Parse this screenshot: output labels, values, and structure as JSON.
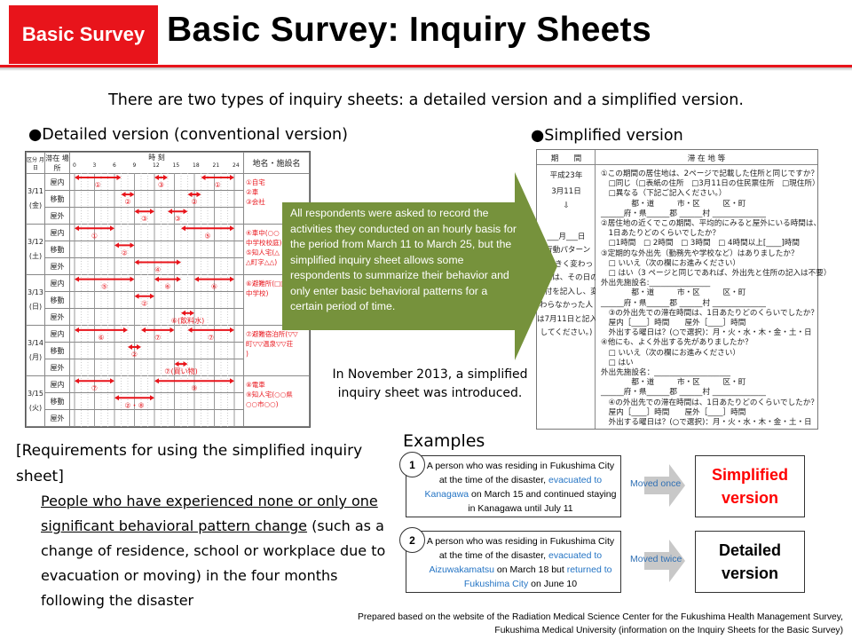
{
  "header": {
    "badge": "Basic Survey",
    "title": "Basic Survey: Inquiry Sheets"
  },
  "intro": "There are two types of inquiry sheets: a detailed version and a simplified version.",
  "detailed": {
    "heading": "●Detailed version (conventional version)",
    "form": {
      "col_date": "区分 月日",
      "col_place": "滞在 場所",
      "col_time": "時 刻",
      "col_names": "地名・施設名",
      "hour_ticks": [
        "0",
        "3",
        "6",
        "9",
        "12",
        "15",
        "18",
        "21",
        "24"
      ],
      "place_types": [
        "屋内",
        "移動",
        "屋外"
      ],
      "days": [
        {
          "date": "3/11",
          "weekday": "(金)",
          "notes": [
            "①自宅",
            "②車",
            "③会社"
          ],
          "rows": [
            [
              [
                0,
                7,
                "①"
              ],
              [
                12,
                14,
                "③"
              ],
              [
                19,
                24,
                "①"
              ]
            ],
            [
              [
                7,
                9,
                "②"
              ],
              [
                17,
                19,
                "②"
              ]
            ],
            [
              [
                9,
                12,
                "③"
              ],
              [
                14,
                17,
                "③"
              ]
            ]
          ]
        },
        {
          "date": "3/12",
          "weekday": "(土)",
          "notes": [
            "④車中(○○",
            "中学校校庭)",
            "⑤知人宅(△",
            "△町字△△)"
          ],
          "rows": [
            [
              [
                0,
                6,
                "①"
              ],
              [
                16,
                24,
                "⑤"
              ]
            ],
            [
              [
                6,
                9,
                "②"
              ]
            ],
            [
              [
                9,
                16,
                "④"
              ]
            ]
          ]
        },
        {
          "date": "3/13",
          "weekday": "(日)",
          "notes": [
            "⑥避難所(□□",
            "中学校)"
          ],
          "rows": [
            [
              [
                0,
                9,
                "⑤"
              ],
              [
                12,
                16,
                "⑥"
              ],
              [
                18,
                24,
                "⑥"
              ]
            ],
            [
              [
                9,
                12,
                "②"
              ]
            ],
            [
              [
                16,
                18,
                "⑥(飲料水)"
              ]
            ]
          ]
        },
        {
          "date": "3/14",
          "weekday": "(月)",
          "notes": [
            "⑦避難宿泊所(▽▽",
            "町▽▽温泉▽▽荘",
            ")"
          ],
          "rows": [
            [
              [
                0,
                8,
                "⑥"
              ],
              [
                10,
                15,
                "⑦"
              ],
              [
                17,
                24,
                "⑦"
              ]
            ],
            [
              [
                8,
                10,
                "②"
              ]
            ],
            [
              [
                15,
                17,
                "⑦(買い物)"
              ]
            ]
          ]
        },
        {
          "date": "3/15",
          "weekday": "(火)",
          "notes": [
            "⑧電車",
            "⑨知人宅(○○県",
            "○○市○○)"
          ],
          "rows": [
            [
              [
                0,
                6,
                "⑦"
              ],
              [
                12,
                24,
                "⑨"
              ]
            ],
            [
              [
                6,
                12,
                "②・⑧"
              ]
            ],
            []
          ]
        }
      ],
      "bar_color": "#e8141b"
    }
  },
  "simplified": {
    "heading": "●Simplified version",
    "form": {
      "col_period": "期　　間",
      "col_stay": "滞 在 地 等",
      "left": [
        "平成23年",
        "3月11日",
        "⇩",
        "___月___日",
        "(行動パターン",
        "が大きく変わっ",
        "た人は、その日の",
        "日付を記入し、変",
        "わらなかった人",
        "は7月11日と記入",
        "してください。)"
      ],
      "lines": [
        "①この期間の居住地は、2ページで記載した住所と同じですか？",
        "　□同じ（□表紙の住所　□3月11日の住民票住所　□現住所）",
        "　□異なる（下記ご記入ください。）",
        "　　　　都・道　　　市・区　　　区・町",
        "______府・県______郡 ______村 ______________",
        "②居住地の近くでこの期間、平均的にみると屋外にいる時間は、",
        "　1日あたりどのくらいでしたか？",
        "　□1時間　□ 2時間　□ 3時間　□ 4時間以上[____]時間",
        "③定期的な外出先（勤務先や学校など）はありましたか？",
        "　□ いいえ（次の欄にお進みください）",
        "　□ はい（3 ページと同じであれば、外出先と住所の記入は不要）",
        "外出先施設名:________________",
        "　　　　都・道　　　市・区　　　区・町",
        "______府・県______郡 ______村 ______________",
        "　③の外出先での滞在時間は、1日あたりどのくらいでしたか？",
        "　屋内［____］時間　　屋外［____］時間",
        "　外出する曜日は？(○で選択)：月・火・水・木・金・土・日",
        "④他にも、よく外出する先がありましたか？",
        "　□ いいえ（次の欄にお進みください）",
        "　□ はい",
        "外出先施設名：____________________",
        "　　　　都・道　　　市・区　　　区・町",
        "______府・県______郡 ______村 ______________",
        "　④の外出先での滞在時間は、1日あたりどのくらいでしたか？",
        "　屋内［____］時間　　屋外［____］時間",
        "　外出する曜日は？(○で選択)：月・火・水・木・金・土・日"
      ]
    }
  },
  "callout": {
    "text": "All respondents were asked to record the activities they conducted on an hourly basis for the period from March 11 to March 25, but the simplified inquiry sheet allows some respondents to summarize their behavior and only enter basic behavioral patterns for a certain period of time.",
    "color": "#76923c"
  },
  "introduced": "In November 2013, a simplified inquiry sheet was introduced.",
  "requirements": {
    "heading": "[Requirements for using the simplified inquiry sheet]",
    "underlined": "People who have experienced none or only one significant behavioral pattern change",
    "rest": " (such as a change of residence, school or workplace due to evacuation or moving) in the four months following the disaster"
  },
  "examples": {
    "heading": "Examples",
    "items": [
      {
        "number": "1",
        "pre": "A person who was residing in Fukushima City at the time of the disaster, ",
        "hl1": "evacuated to Kanagawa",
        "mid": " on March 15 and continued staying in Kanagawa until July 11",
        "hl2": "",
        "post": "",
        "moved": "Moved once",
        "result": "Simplified version",
        "result_color": "#ff0000"
      },
      {
        "number": "2",
        "pre": "A person who was residing in Fukushima City at the time of the disaster, ",
        "hl1": "evacuated to Aizuwakamatsu",
        "mid": " on March 18 but ",
        "hl2": "returned to Fukushima City",
        "post": " on June 10",
        "moved": "Moved twice",
        "result": "Detailed version",
        "result_color": "#000000"
      }
    ]
  },
  "source": {
    "line1": "Prepared based on the website of the Radiation Medical Science Center for the Fukushima Health Management Survey,",
    "line2": "Fukushima Medical University (information on the Inquiry Sheets for the Basic Survey)"
  }
}
